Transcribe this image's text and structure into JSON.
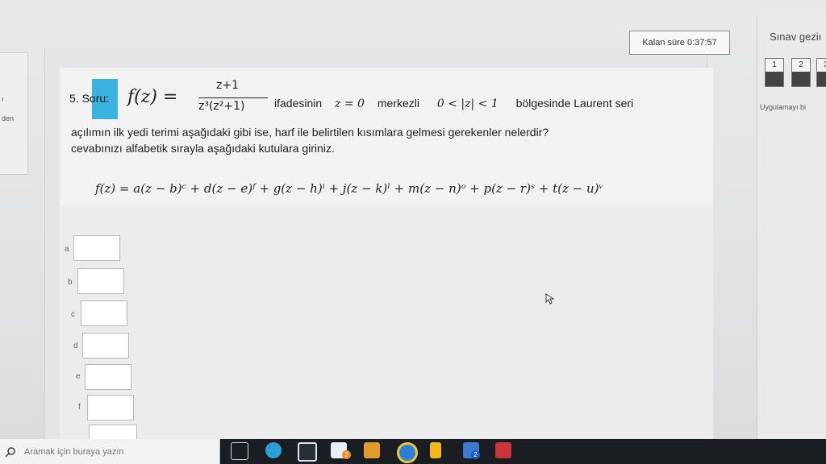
{
  "timer": {
    "label": "Kalan süre 0:37:57"
  },
  "sidebar_left": {
    "fragment_top": "ı",
    "fragment_bottom": "den"
  },
  "right_panel": {
    "title": "Sınav geziı",
    "question_numbers": [
      "1",
      "2",
      "3"
    ],
    "apply_text": "Uygulamayı bi"
  },
  "question": {
    "number": "5.",
    "tag": "Soru:",
    "fz": "f(z) =",
    "numerator": "z+1",
    "denominator": "z³(z²+1)",
    "line1_a": "ifadesinin",
    "line1_math": "z = 0",
    "line1_b": "merkezli",
    "line1_region": "0 < |z| < 1",
    "line1_c": "bölgesinde Laurent seri",
    "line2": "açılımın ilk yedi terimi aşağıdaki gibi ise, harf ile belirtilen kısımlara gelmesi gerekenler nelerdir?",
    "line3": "cevabınızı alfabetik sırayla aşağıdaki kutulara giriniz.",
    "formula": "f(z) = a(z − b)ᶜ + d(z − e)ᶠ + g(z − h)ⁱ + j(z − k)ˡ + m(z − n)ᵒ + p(z − r)ˢ + t(z − u)ᵛ"
  },
  "answers": [
    {
      "label": "a",
      "value": ""
    },
    {
      "label": "b",
      "value": ""
    },
    {
      "label": "c",
      "value": ""
    },
    {
      "label": "d",
      "value": ""
    },
    {
      "label": "e",
      "value": ""
    },
    {
      "label": "f",
      "value": ""
    }
  ],
  "taskbar": {
    "search_placeholder": "Aramak için buraya yazın",
    "badges": [
      "2",
      "2"
    ],
    "icons": [
      "task-view-icon",
      "edge-icon",
      "store-icon",
      "mail-icon",
      "calendar-icon",
      "chrome-icon",
      "file-icon",
      "photos-icon",
      "word-icon"
    ]
  },
  "colors": {
    "soru_highlight": "#3bb3e0",
    "taskbar": "#1a1d22"
  }
}
